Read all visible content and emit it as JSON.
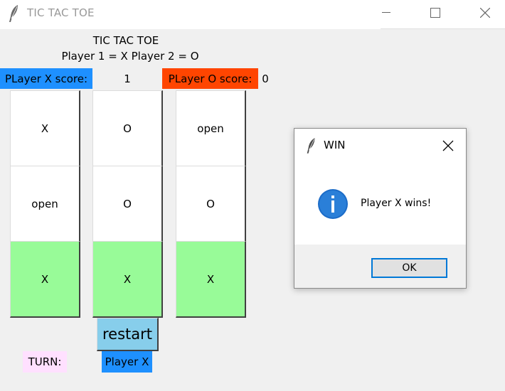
{
  "window": {
    "title": "TIC TAC TOE",
    "icon": "feather-icon"
  },
  "header": {
    "title": "TIC TAC TOE",
    "players_line": "Player 1 = X   Player 2 = O"
  },
  "scores": {
    "x_label": "PLayer X score:",
    "x_value": "1",
    "x_color": "#1e90ff",
    "o_label": "PLayer O score:",
    "o_value": "0",
    "o_color": "#ff4500"
  },
  "board": {
    "cells": [
      "X",
      "O",
      "open",
      "open",
      "O",
      "O",
      "X",
      "X",
      "X"
    ],
    "winning_row": 2,
    "win_color": "#98fb98"
  },
  "controls": {
    "restart_label": "restart",
    "turn_label": "TURN:",
    "turn_value": "Player X",
    "turn_label_color": "#ffe0ff",
    "turn_value_color": "#1e90ff"
  },
  "dialog": {
    "title": "WIN",
    "message": "Player X wins!",
    "ok_label": "OK",
    "icon": "info-icon"
  }
}
